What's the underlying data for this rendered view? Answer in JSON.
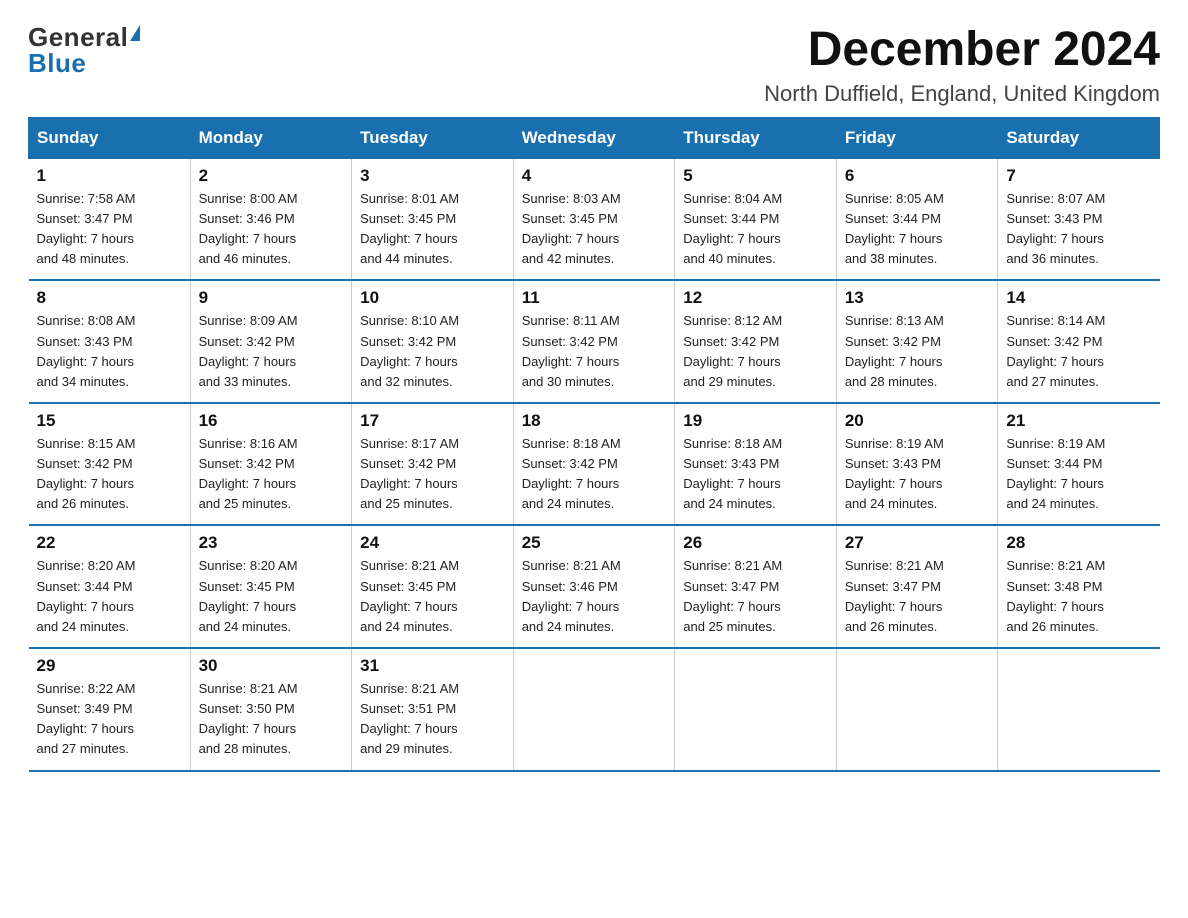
{
  "logo": {
    "general": "General",
    "blue": "Blue"
  },
  "title": "December 2024",
  "subtitle": "North Duffield, England, United Kingdom",
  "days_of_week": [
    "Sunday",
    "Monday",
    "Tuesday",
    "Wednesday",
    "Thursday",
    "Friday",
    "Saturday"
  ],
  "weeks": [
    [
      {
        "day": "1",
        "info": "Sunrise: 7:58 AM\nSunset: 3:47 PM\nDaylight: 7 hours\nand 48 minutes."
      },
      {
        "day": "2",
        "info": "Sunrise: 8:00 AM\nSunset: 3:46 PM\nDaylight: 7 hours\nand 46 minutes."
      },
      {
        "day": "3",
        "info": "Sunrise: 8:01 AM\nSunset: 3:45 PM\nDaylight: 7 hours\nand 44 minutes."
      },
      {
        "day": "4",
        "info": "Sunrise: 8:03 AM\nSunset: 3:45 PM\nDaylight: 7 hours\nand 42 minutes."
      },
      {
        "day": "5",
        "info": "Sunrise: 8:04 AM\nSunset: 3:44 PM\nDaylight: 7 hours\nand 40 minutes."
      },
      {
        "day": "6",
        "info": "Sunrise: 8:05 AM\nSunset: 3:44 PM\nDaylight: 7 hours\nand 38 minutes."
      },
      {
        "day": "7",
        "info": "Sunrise: 8:07 AM\nSunset: 3:43 PM\nDaylight: 7 hours\nand 36 minutes."
      }
    ],
    [
      {
        "day": "8",
        "info": "Sunrise: 8:08 AM\nSunset: 3:43 PM\nDaylight: 7 hours\nand 34 minutes."
      },
      {
        "day": "9",
        "info": "Sunrise: 8:09 AM\nSunset: 3:42 PM\nDaylight: 7 hours\nand 33 minutes."
      },
      {
        "day": "10",
        "info": "Sunrise: 8:10 AM\nSunset: 3:42 PM\nDaylight: 7 hours\nand 32 minutes."
      },
      {
        "day": "11",
        "info": "Sunrise: 8:11 AM\nSunset: 3:42 PM\nDaylight: 7 hours\nand 30 minutes."
      },
      {
        "day": "12",
        "info": "Sunrise: 8:12 AM\nSunset: 3:42 PM\nDaylight: 7 hours\nand 29 minutes."
      },
      {
        "day": "13",
        "info": "Sunrise: 8:13 AM\nSunset: 3:42 PM\nDaylight: 7 hours\nand 28 minutes."
      },
      {
        "day": "14",
        "info": "Sunrise: 8:14 AM\nSunset: 3:42 PM\nDaylight: 7 hours\nand 27 minutes."
      }
    ],
    [
      {
        "day": "15",
        "info": "Sunrise: 8:15 AM\nSunset: 3:42 PM\nDaylight: 7 hours\nand 26 minutes."
      },
      {
        "day": "16",
        "info": "Sunrise: 8:16 AM\nSunset: 3:42 PM\nDaylight: 7 hours\nand 25 minutes."
      },
      {
        "day": "17",
        "info": "Sunrise: 8:17 AM\nSunset: 3:42 PM\nDaylight: 7 hours\nand 25 minutes."
      },
      {
        "day": "18",
        "info": "Sunrise: 8:18 AM\nSunset: 3:42 PM\nDaylight: 7 hours\nand 24 minutes."
      },
      {
        "day": "19",
        "info": "Sunrise: 8:18 AM\nSunset: 3:43 PM\nDaylight: 7 hours\nand 24 minutes."
      },
      {
        "day": "20",
        "info": "Sunrise: 8:19 AM\nSunset: 3:43 PM\nDaylight: 7 hours\nand 24 minutes."
      },
      {
        "day": "21",
        "info": "Sunrise: 8:19 AM\nSunset: 3:44 PM\nDaylight: 7 hours\nand 24 minutes."
      }
    ],
    [
      {
        "day": "22",
        "info": "Sunrise: 8:20 AM\nSunset: 3:44 PM\nDaylight: 7 hours\nand 24 minutes."
      },
      {
        "day": "23",
        "info": "Sunrise: 8:20 AM\nSunset: 3:45 PM\nDaylight: 7 hours\nand 24 minutes."
      },
      {
        "day": "24",
        "info": "Sunrise: 8:21 AM\nSunset: 3:45 PM\nDaylight: 7 hours\nand 24 minutes."
      },
      {
        "day": "25",
        "info": "Sunrise: 8:21 AM\nSunset: 3:46 PM\nDaylight: 7 hours\nand 24 minutes."
      },
      {
        "day": "26",
        "info": "Sunrise: 8:21 AM\nSunset: 3:47 PM\nDaylight: 7 hours\nand 25 minutes."
      },
      {
        "day": "27",
        "info": "Sunrise: 8:21 AM\nSunset: 3:47 PM\nDaylight: 7 hours\nand 26 minutes."
      },
      {
        "day": "28",
        "info": "Sunrise: 8:21 AM\nSunset: 3:48 PM\nDaylight: 7 hours\nand 26 minutes."
      }
    ],
    [
      {
        "day": "29",
        "info": "Sunrise: 8:22 AM\nSunset: 3:49 PM\nDaylight: 7 hours\nand 27 minutes."
      },
      {
        "day": "30",
        "info": "Sunrise: 8:21 AM\nSunset: 3:50 PM\nDaylight: 7 hours\nand 28 minutes."
      },
      {
        "day": "31",
        "info": "Sunrise: 8:21 AM\nSunset: 3:51 PM\nDaylight: 7 hours\nand 29 minutes."
      },
      null,
      null,
      null,
      null
    ]
  ]
}
